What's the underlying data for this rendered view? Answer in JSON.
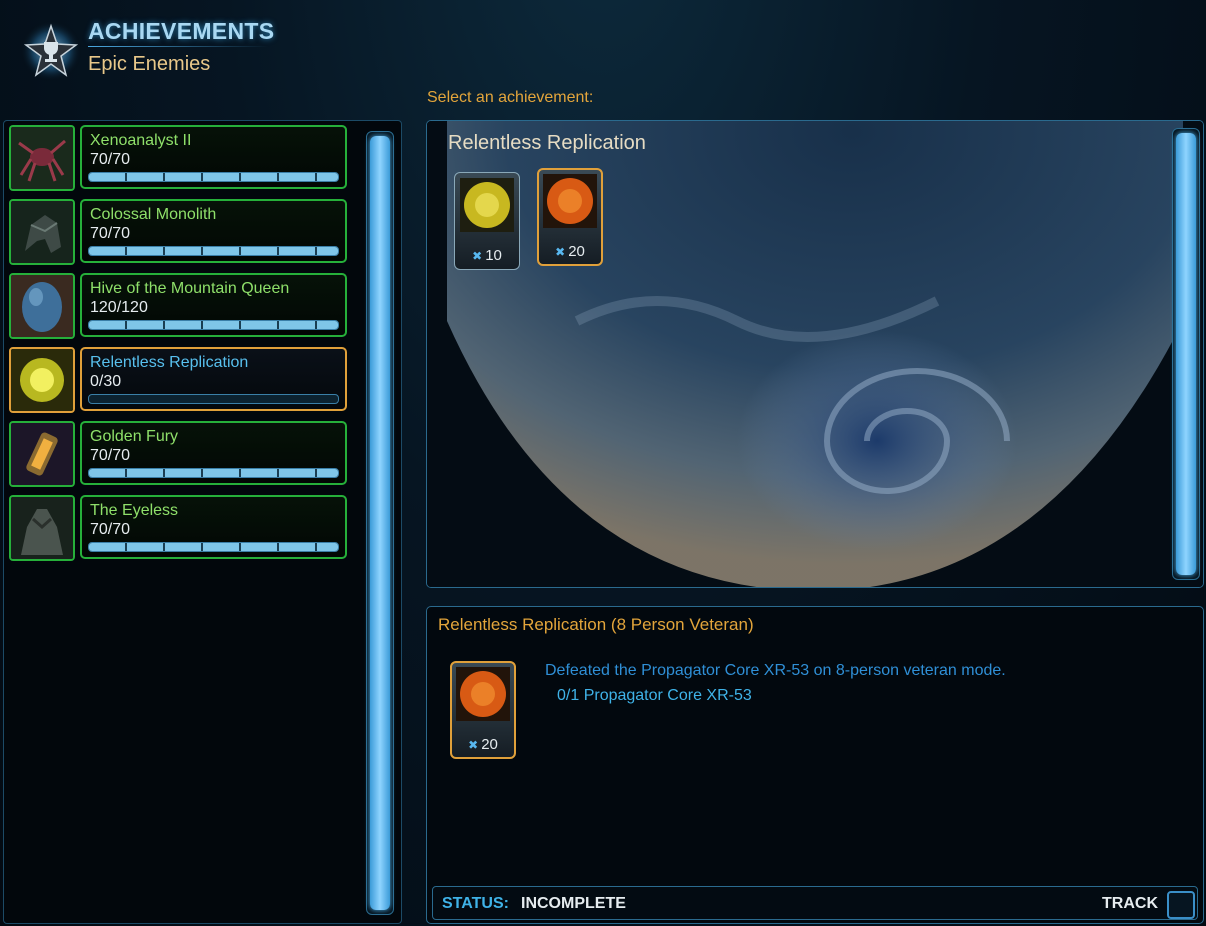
{
  "header": {
    "title": "ACHIEVEMENTS",
    "subtitle": "Epic Enemies",
    "prompt": "Select an achievement:"
  },
  "achievements": [
    {
      "name": "Xenoanalyst II",
      "count": "70/70",
      "progress": 1.0,
      "icon": "creature-icon",
      "selected": false
    },
    {
      "name": "Colossal Monolith",
      "count": "70/70",
      "progress": 1.0,
      "icon": "monolith-icon",
      "selected": false
    },
    {
      "name": "Hive of the Mountain Queen",
      "count": "120/120",
      "progress": 1.0,
      "icon": "egg-icon",
      "selected": false
    },
    {
      "name": "Relentless Replication",
      "count": "0/30",
      "progress": 0.0,
      "icon": "core-icon",
      "selected": true
    },
    {
      "name": "Golden Fury",
      "count": "70/70",
      "progress": 1.0,
      "icon": "canister-icon",
      "selected": false
    },
    {
      "name": "The Eyeless",
      "count": "70/70",
      "progress": 1.0,
      "icon": "eyeless-icon",
      "selected": false
    }
  ],
  "viewer": {
    "title": "Relentless Replication",
    "rewards": [
      {
        "points": "10",
        "orb": "yellow-orb-icon"
      },
      {
        "points": "20",
        "orb": "orange-orb-icon"
      }
    ]
  },
  "detail": {
    "title": "Relentless Replication (8 Person Veteran)",
    "description": "Defeated the Propagator Core XR-53 on 8-person veteran mode.",
    "objective": "0/1 Propagator Core XR-53",
    "reward_points": "20",
    "status_label": "STATUS:",
    "status_value": "INCOMPLETE",
    "track_label": "TRACK"
  },
  "colors": {
    "complete_border": "#26b03a",
    "selected_border": "#e0a03a",
    "accent_blue": "#3fb3e8",
    "accent_gold": "#e3a53b"
  }
}
